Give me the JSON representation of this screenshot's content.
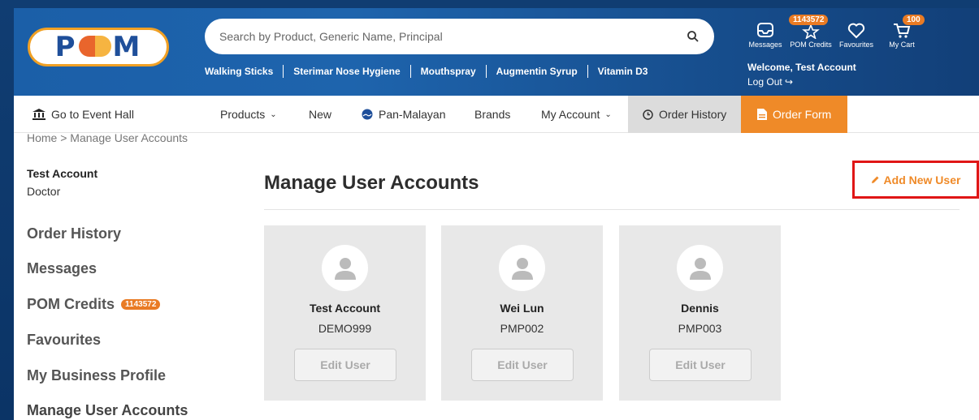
{
  "header": {
    "logo_text": "POM",
    "search_placeholder": "Search by Product, Generic Name, Principal",
    "quick_links": [
      "Walking Sticks",
      "Sterimar Nose Hygiene",
      "Mouthspray",
      "Augmentin Syrup",
      "Vitamin D3"
    ],
    "icons": {
      "messages": "Messages",
      "pom_credits": "POM Credits",
      "pom_credits_badge": "1143572",
      "favourites": "Favourites",
      "cart": "My Cart",
      "cart_badge": "100"
    },
    "welcome": "Welcome, Test Account",
    "logout": "Log Out"
  },
  "nav": {
    "event_hall": "Go to Event Hall",
    "products": "Products",
    "new": "New",
    "pan_malayan": "Pan-Malayan",
    "brands": "Brands",
    "my_account": "My Account",
    "order_history": "Order History",
    "order_form": "Order Form"
  },
  "breadcrumb": "Home > Manage User Accounts",
  "sidebar": {
    "name": "Test Account",
    "role": "Doctor",
    "links": [
      "Order History",
      "Messages",
      "POM Credits",
      "Favourites",
      "My Business Profile",
      "Manage User Accounts"
    ],
    "credits_badge": "1143572"
  },
  "main": {
    "title": "Manage User Accounts",
    "add_user": "Add New User",
    "users": [
      {
        "name": "Test Account",
        "code": "DEMO999",
        "edit": "Edit User"
      },
      {
        "name": "Wei Lun",
        "code": "PMP002",
        "edit": "Edit User"
      },
      {
        "name": "Dennis",
        "code": "PMP003",
        "edit": "Edit User"
      }
    ]
  },
  "colors": {
    "brand_blue": "#1b5fa8",
    "accent_orange": "#ef8a28",
    "highlight_red": "#e01616"
  }
}
